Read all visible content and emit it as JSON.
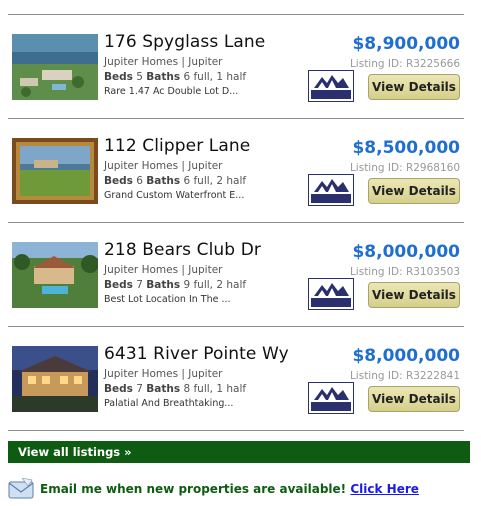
{
  "listings": [
    {
      "title": "176 Spyglass Lane",
      "area": "Jupiter Homes | Jupiter",
      "beds_label": "Beds",
      "beds": "5",
      "baths_label": "Baths",
      "baths": "6 full, 1 half",
      "desc": "Rare 1.47 Ac Double Lot D...",
      "price": "$8,900,000",
      "listing_id": "Listing ID: R3225666",
      "button": "View Details",
      "logo_text": "RMLS"
    },
    {
      "title": "112 Clipper Lane",
      "area": "Jupiter Homes | Jupiter",
      "beds_label": "Beds",
      "beds": "6",
      "baths_label": "Baths",
      "baths": "6 full, 2 half",
      "desc": "Grand Custom Waterfront E...",
      "price": "$8,500,000",
      "listing_id": "Listing ID: R2968160",
      "button": "View Details",
      "logo_text": "RMLS"
    },
    {
      "title": "218 Bears Club Dr",
      "area": "Jupiter Homes | Jupiter",
      "beds_label": "Beds",
      "beds": "7",
      "baths_label": "Baths",
      "baths": "9 full, 2 half",
      "desc": "Best Lot Location In The ...",
      "price": "$8,000,000",
      "listing_id": "Listing ID: R3103503",
      "button": "View Details",
      "logo_text": "RMLS"
    },
    {
      "title": "6431 River Pointe Wy",
      "area": "Jupiter Homes | Jupiter",
      "beds_label": "Beds",
      "beds": "7",
      "baths_label": "Baths",
      "baths": "8 full, 1 half",
      "desc": "Palatial And Breathtaking...",
      "price": "$8,000,000",
      "listing_id": "Listing ID: R3222841",
      "button": "View Details",
      "logo_text": "RMLS"
    }
  ],
  "view_all": "View all listings »",
  "email": {
    "text": "Email me when new properties are available!",
    "link": "Click Here"
  },
  "colors": {
    "price": "#1f6fd0",
    "bar": "#0d5c12",
    "link": "#1a1aee"
  }
}
